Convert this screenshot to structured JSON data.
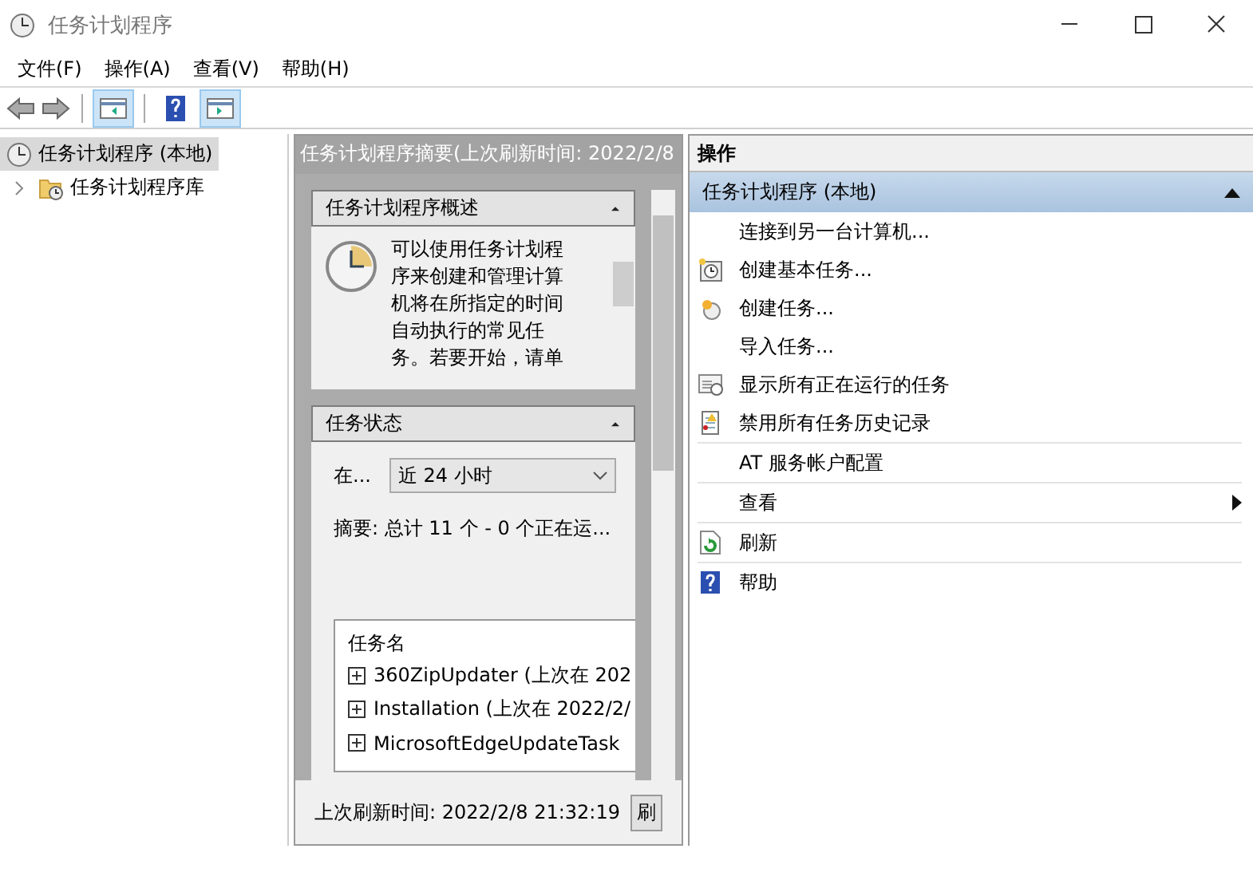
{
  "window": {
    "title": "任务计划程序"
  },
  "menu": [
    "文件(F)",
    "操作(A)",
    "查看(V)",
    "帮助(H)"
  ],
  "toolbar": [
    {
      "kind": "back",
      "disabled": true
    },
    {
      "kind": "forward",
      "disabled": true
    },
    {
      "kind": "console-tree",
      "pressed": true
    },
    {
      "kind": "help",
      "pressed": false
    },
    {
      "kind": "action-pane",
      "pressed": true
    }
  ],
  "tree": [
    {
      "label": "任务计划程序 (本地)",
      "selected": true,
      "children": [
        {
          "label": "任务计划程序库",
          "selected": false,
          "expanded": false
        }
      ]
    }
  ],
  "summary": {
    "header": "任务计划程序摘要(上次刷新时间: 2022/2/8",
    "overview": {
      "title": "任务计划程序概述",
      "expanded": true,
      "text": "可以使用任务计划程序来创建和管理计算机将在所指定的时间自动执行的常见任务。若要开始，请单"
    },
    "status": {
      "title": "任务状态",
      "expanded": true,
      "period_label": "在...",
      "period": "近 24 小时",
      "summary": "摘要: 总计 11 个 - 0 个正在运...",
      "columns": [
        "任务名"
      ],
      "tasks": [
        "360ZipUpdater (上次在 202",
        "Installation (上次在 2022/2/",
        "MicrosoftEdgeUpdateTask"
      ]
    },
    "last_refresh": "上次刷新时间: 2022/2/8 21:32:19",
    "refresh_button": "刷"
  },
  "actions": {
    "header": "操作",
    "group": {
      "title": "任务计划程序 (本地)",
      "expanded": true
    },
    "items": [
      {
        "label": "连接到另一台计算机...",
        "kind": "plain",
        "separator_before": false,
        "submenu": false
      },
      {
        "label": "创建基本任务...",
        "kind": "basic-task",
        "separator_before": false,
        "submenu": false
      },
      {
        "label": "创建任务...",
        "kind": "task",
        "separator_before": false,
        "submenu": false
      },
      {
        "label": "导入任务...",
        "kind": "plain",
        "separator_before": false,
        "submenu": false
      },
      {
        "label": "显示所有正在运行的任务",
        "kind": "running",
        "separator_before": false,
        "submenu": false
      },
      {
        "label": "禁用所有任务历史记录",
        "kind": "history",
        "separator_before": false,
        "submenu": false
      },
      {
        "label": "AT 服务帐户配置",
        "kind": "plain",
        "separator_before": true,
        "submenu": false
      },
      {
        "label": "查看",
        "kind": "plain",
        "separator_before": true,
        "submenu": true
      },
      {
        "label": "刷新",
        "kind": "refresh",
        "separator_before": true,
        "submenu": false
      },
      {
        "label": "帮助",
        "kind": "help",
        "separator_before": true,
        "submenu": false
      }
    ]
  }
}
